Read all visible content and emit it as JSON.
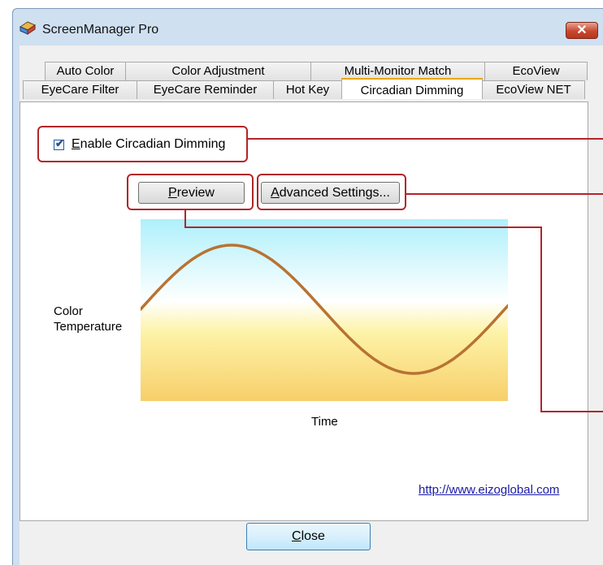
{
  "window": {
    "title": "ScreenManager Pro",
    "close_glyph": "✕",
    "icon": "screenmanager-app-icon"
  },
  "tabs": {
    "row_back": [
      "Auto Color",
      "Color Adjustment",
      "Multi-Monitor Match",
      "EcoView"
    ],
    "row_front": [
      "EyeCare Filter",
      "EyeCare Reminder",
      "Hot Key",
      "Circadian Dimming",
      "EcoView NET"
    ],
    "active": "Circadian Dimming"
  },
  "circadian": {
    "enable_label_first": "E",
    "enable_label_rest": "nable Circadian Dimming",
    "enable_checked": true,
    "preview_first": "P",
    "preview_rest": "review",
    "advanced_first": "A",
    "advanced_rest": "dvanced Settings..."
  },
  "chart_data": {
    "type": "line",
    "ylabel_line1": "Color",
    "ylabel_line2": "Temperature",
    "xlabel": "Time",
    "curve": "sine",
    "line_color": "#b87333",
    "gradient_top": "#aef0fb",
    "gradient_bottom": "#f7cf6a"
  },
  "footer": {
    "url": "http://www.eizoglobal.com",
    "close_first": "C",
    "close_rest": "lose"
  },
  "colors": {
    "callout": "#b3242a",
    "active_tab_accent": "#e8a800"
  }
}
